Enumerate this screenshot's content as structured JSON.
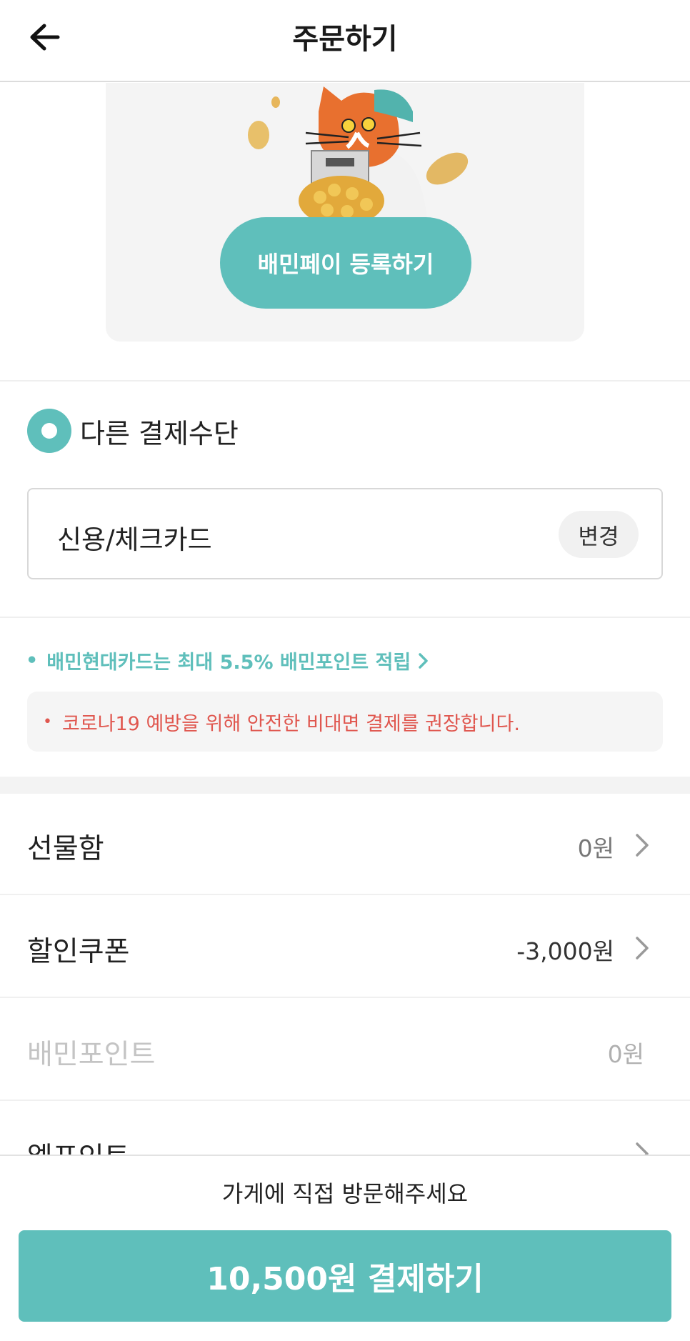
{
  "header": {
    "title": "주문하기",
    "back_icon": "arrow-left-icon"
  },
  "promo": {
    "register_label": "배민페이 등록하기",
    "mascot": "cat-mascot-with-treasure-chest"
  },
  "payment": {
    "other_method_label": "다른 결제수단",
    "selected_method": "신용/체크카드",
    "change_label": "변경"
  },
  "card_promo": {
    "bullet": "•",
    "text": "배민현대카드는 최대 5.5% 배민포인트 적립",
    "chevron": "›"
  },
  "notice": {
    "bullet": "•",
    "text": "코로나19 예방을 위해 안전한 비대면 결제를 권장합니다."
  },
  "discounts": [
    {
      "label": "선물함",
      "value": "0원"
    },
    {
      "label": "할인쿠폰",
      "value": "-3,000원"
    },
    {
      "label": "배민포인트",
      "value": "0원"
    },
    {
      "label": "엘포인트",
      "value": ""
    }
  ],
  "bottom": {
    "visit_text": "가게에 직접 방문해주세요",
    "pay_label": "10,500원 결제하기"
  },
  "colors": {
    "accent": "#5fbfbb",
    "notice": "#e0574f"
  }
}
